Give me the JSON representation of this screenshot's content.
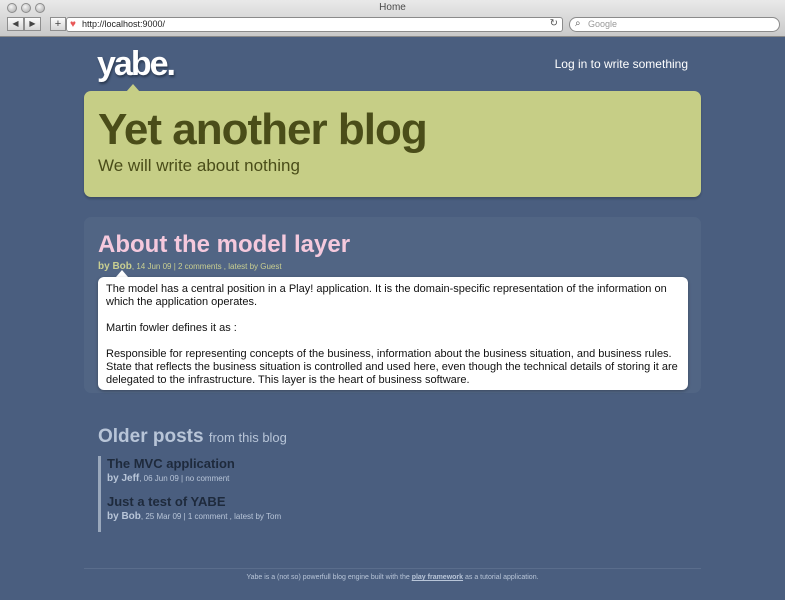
{
  "browser": {
    "window_title": "Home",
    "url": "http://localhost:9000/",
    "search_placeholder": "Google",
    "back": "◀",
    "forward": "▶",
    "new_tab": "+",
    "reload": "↻",
    "search_glyph": "⌕",
    "favicon": "♥"
  },
  "header": {
    "logo": "yabe.",
    "login_link": "Log in to write something"
  },
  "hero": {
    "title": "Yet another blog",
    "subtitle": "We will write about nothing"
  },
  "featured_post": {
    "title": "About the model layer",
    "author": "by Bob",
    "meta": ", 14 Jun 09  |  2 comments , latest by Guest",
    "paragraphs": [
      "The model has a central position in a Play! application. It is the domain-specific representation of the information on which the application operates.",
      "Martin fowler defines it as :",
      "Responsible for representing concepts of the business, information about the business situation, and business rules. State that reflects the business situation is controlled and used here, even though the technical details of storing it are delegated to the infrastructure. This layer is the heart of business software."
    ]
  },
  "older_posts": {
    "heading": "Older posts",
    "heading_suffix": "from this blog",
    "items": [
      {
        "title": "The MVC application",
        "author": "by Jeff",
        "meta": ", 06 Jun 09  |  no comment"
      },
      {
        "title": "Just a test of YABE",
        "author": "by Bob",
        "meta": ", 25 Mar 09  |  1 comment , latest by Tom"
      }
    ]
  },
  "footer": {
    "text_before": "Yabe is a (not so) powerfull blog engine built with the ",
    "link": "play framework",
    "text_after": " as a tutorial application."
  },
  "colors": {
    "page_bg": "#4a5e7f",
    "hero_bg": "#c6ce86",
    "post_title": "#f5c9dd"
  }
}
